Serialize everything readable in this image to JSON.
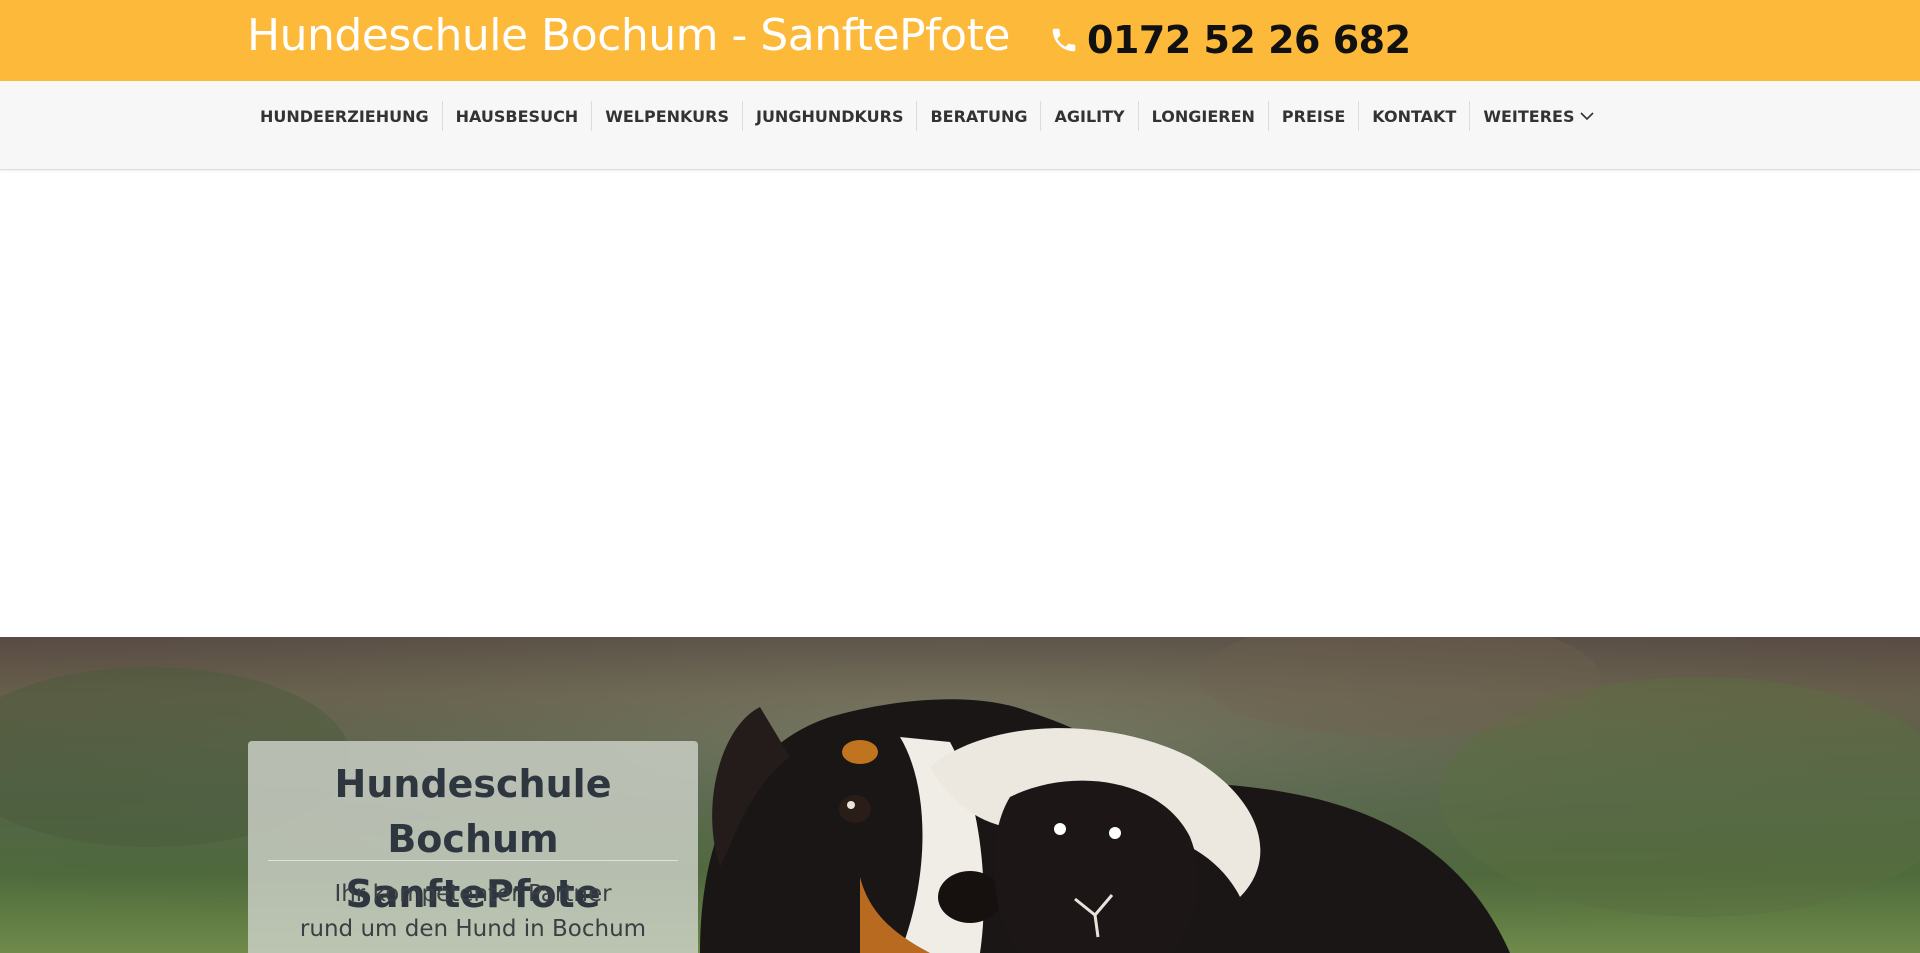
{
  "header": {
    "site_title": "Hundeschule Bochum - SanftePfote",
    "phone_number": "0172 52 26 682",
    "phone_icon": "phone-icon",
    "background_color": "#fdb93a"
  },
  "nav": {
    "items": [
      {
        "label": "HUNDEERZIEHUNG"
      },
      {
        "label": "HAUSBESUCH"
      },
      {
        "label": "WELPENKURS"
      },
      {
        "label": "JUNGHUNDKURS"
      },
      {
        "label": "BERATUNG"
      },
      {
        "label": "AGILITY"
      },
      {
        "label": "LONGIEREN"
      },
      {
        "label": "PREISE"
      },
      {
        "label": "KONTAKT"
      },
      {
        "label": "WEITERES",
        "icon": "chevron-down-icon"
      }
    ]
  },
  "hero": {
    "heading_line1": "Hundeschule Bochum",
    "heading_line2": "SanftePfote",
    "subtitle_line1": "Ihr kompetenter Partner",
    "subtitle_line2": "rund um den Hund in Bochum"
  }
}
